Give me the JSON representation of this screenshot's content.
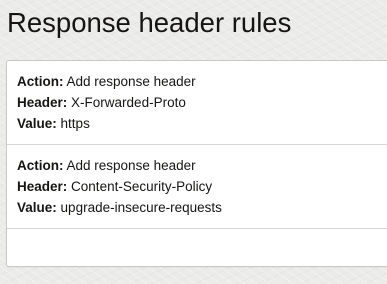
{
  "page": {
    "title": "Response header rules"
  },
  "rules": [
    {
      "action_label": "Action:",
      "action_value": "Add response header",
      "header_label": "Header:",
      "header_value": "X-Forwarded-Proto",
      "value_label": "Value:",
      "value_value": "https"
    },
    {
      "action_label": "Action:",
      "action_value": "Add response header",
      "header_label": "Header:",
      "header_value": "Content-Security-Policy",
      "value_label": "Value:",
      "value_value": "upgrade-insecure-requests"
    }
  ],
  "colors": {
    "page_background": "#ebebea",
    "panel_background": "#ffffff",
    "text": "#161513",
    "border": "#c9c8c5"
  }
}
